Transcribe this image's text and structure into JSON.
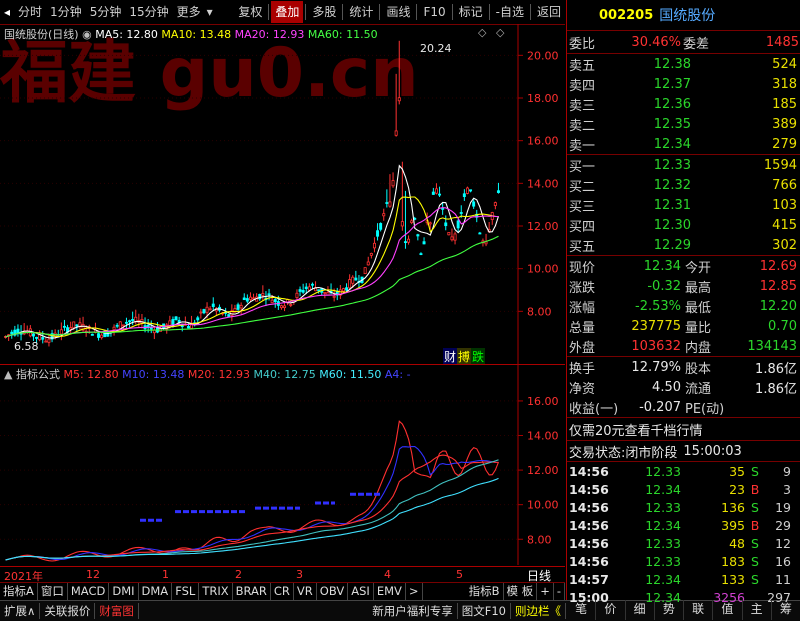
{
  "toolbar": {
    "items": [
      "分时",
      "1分钟",
      "5分钟",
      "15分钟",
      "更多"
    ],
    "items2": [
      "复权",
      "叠加",
      "多股",
      "统计",
      "画线",
      "F10",
      "标记",
      "-自选",
      "返回"
    ],
    "active": "叠加"
  },
  "stock": {
    "code": "002205",
    "name": "国统股份"
  },
  "main_chart": {
    "title": "国统股份(日线)",
    "ma": [
      {
        "label": "MA5: 12.80",
        "color": "#ffffff"
      },
      {
        "label": "MA10: 13.48",
        "color": "#ffff00"
      },
      {
        "label": "MA20: 12.93",
        "color": "#ff40ff"
      },
      {
        "label": "MA60: 11.50",
        "color": "#40ff40"
      }
    ],
    "y_ticks": [
      "20.00",
      "18.00",
      "16.00",
      "14.00",
      "12.00",
      "10.00",
      "8.00"
    ],
    "high_label": "20.24",
    "low_label": "6.58",
    "watermark": "福建 gu0.cn",
    "badges": [
      "财",
      "搏",
      "跌"
    ],
    "icons": [
      "◇",
      "◇"
    ]
  },
  "indicator": {
    "title": "指标公式",
    "lines": [
      {
        "label": "M5: 12.80",
        "color": "#ff3030"
      },
      {
        "label": "M10: 13.48",
        "color": "#3030ff"
      },
      {
        "label": "M20: 12.93",
        "color": "#ff3030"
      },
      {
        "label": "M40: 12.75",
        "color": "#40c0c0"
      },
      {
        "label": "M60: 11.50",
        "color": "#40e0ff"
      },
      {
        "label": "A4: -",
        "color": "#4040ff"
      }
    ],
    "y_ticks": [
      "16.00",
      "14.00",
      "12.00",
      "10.00",
      "8.00"
    ]
  },
  "x_axis": {
    "labels": [
      "2021年",
      "12",
      "1",
      "2",
      "3",
      "4",
      "5"
    ],
    "period": "日线"
  },
  "bottom_tabs": [
    "指标A",
    "窗口",
    "MACD",
    "DMI",
    "DMA",
    "FSL",
    "TRIX",
    "BRAR",
    "CR",
    "VR",
    "OBV",
    "ASI",
    "EMV",
    ">",
    "指标B",
    "模 板",
    "+",
    "-"
  ],
  "status_bar": {
    "items": [
      "扩展∧",
      "关联报价",
      "财富图"
    ],
    "right": [
      "新用户福利专享",
      "图文F10",
      "则边栏《"
    ]
  },
  "order_book": {
    "ratio_label": "委比",
    "ratio": "30.46%",
    "diff_label": "委差",
    "diff": "1485",
    "sell": [
      {
        "label": "卖五",
        "price": "12.38",
        "vol": "524"
      },
      {
        "label": "卖四",
        "price": "12.37",
        "vol": "318"
      },
      {
        "label": "卖三",
        "price": "12.36",
        "vol": "185"
      },
      {
        "label": "卖二",
        "price": "12.35",
        "vol": "389"
      },
      {
        "label": "卖一",
        "price": "12.34",
        "vol": "279"
      }
    ],
    "buy": [
      {
        "label": "买一",
        "price": "12.33",
        "vol": "1594"
      },
      {
        "label": "买二",
        "price": "12.32",
        "vol": "766"
      },
      {
        "label": "买三",
        "price": "12.31",
        "vol": "103"
      },
      {
        "label": "买四",
        "price": "12.30",
        "vol": "415"
      },
      {
        "label": "买五",
        "price": "12.29",
        "vol": "302"
      }
    ]
  },
  "quote": [
    {
      "l1": "现价",
      "v1": "12.34",
      "c1": "green",
      "l2": "今开",
      "v2": "12.69",
      "c2": "red"
    },
    {
      "l1": "涨跌",
      "v1": "-0.32",
      "c1": "green",
      "l2": "最高",
      "v2": "12.85",
      "c2": "red"
    },
    {
      "l1": "涨幅",
      "v1": "-2.53%",
      "c1": "green",
      "l2": "最低",
      "v2": "12.20",
      "c2": "green"
    },
    {
      "l1": "总量",
      "v1": "237775",
      "c1": "yellow",
      "l2": "量比",
      "v2": "0.70",
      "c2": "green"
    },
    {
      "l1": "外盘",
      "v1": "103632",
      "c1": "red",
      "l2": "内盘",
      "v2": "134143",
      "c2": "green"
    }
  ],
  "quote2": [
    {
      "l1": "换手",
      "v1": "12.79%",
      "l2": "股本",
      "v2": "1.86亿"
    },
    {
      "l1": "净资",
      "v1": "4.50",
      "l2": "流通",
      "v2": "1.86亿"
    },
    {
      "l1": "收益(一)",
      "v1": "-0.207",
      "l2": "PE(动)",
      "v2": ""
    }
  ],
  "promo": "仅需20元查看千档行情",
  "trade_status": {
    "label": "交易状态:",
    "value": "闭市阶段",
    "time": "15:00:03"
  },
  "ticks": [
    {
      "time": "14:56",
      "price": "12.33",
      "vol": "35",
      "bs": "S",
      "n": "9"
    },
    {
      "time": "14:56",
      "price": "12.34",
      "vol": "23",
      "bs": "B",
      "n": "3"
    },
    {
      "time": "14:56",
      "price": "12.33",
      "vol": "136",
      "bs": "S",
      "n": "19"
    },
    {
      "time": "14:56",
      "price": "12.34",
      "vol": "395",
      "bs": "B",
      "n": "29"
    },
    {
      "time": "14:56",
      "price": "12.33",
      "vol": "48",
      "bs": "S",
      "n": "12"
    },
    {
      "time": "14:56",
      "price": "12.33",
      "vol": "183",
      "bs": "S",
      "n": "16"
    },
    {
      "time": "14:57",
      "price": "12.34",
      "vol": "133",
      "bs": "S",
      "n": "11"
    },
    {
      "time": "15:00",
      "price": "12.34",
      "vol": "3256",
      "bs": "",
      "n": "297"
    }
  ],
  "right_tabs": [
    "笔",
    "价",
    "细",
    "势",
    "联",
    "值",
    "主",
    "筹"
  ]
}
